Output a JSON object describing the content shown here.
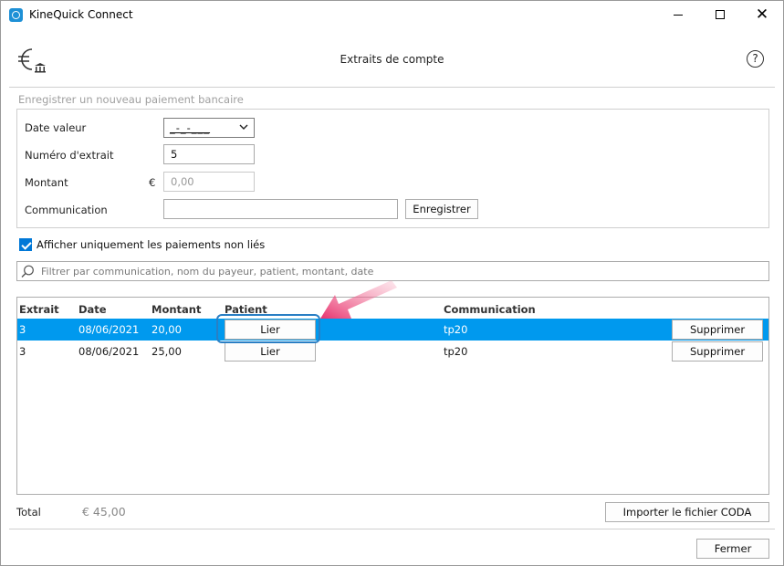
{
  "window": {
    "app_title": "KineQuick Connect",
    "icon": "kinequick-logo-icon"
  },
  "header": {
    "title": "Extraits de compte",
    "help_glyph": "?",
    "left_icon": "euro-bank-icon",
    "right_icon": "help-icon"
  },
  "form": {
    "group_title": "Enregistrer un nouveau paiement bancaire",
    "date_label": "Date valeur",
    "date_value": "_-_-___",
    "extract_label": "Numéro d'extrait",
    "extract_value": "5",
    "amount_label": "Montant",
    "currency_symbol": "€",
    "amount_placeholder": "0,00",
    "communication_label": "Communication",
    "communication_value": "",
    "save_label": "Enregistrer"
  },
  "filter": {
    "only_unlinked_label": "Afficher uniquement les paiements non liés",
    "only_unlinked_checked": true,
    "search_placeholder": "Filtrer par communication, nom du payeur, patient, montant, date"
  },
  "table": {
    "headers": {
      "extract": "Extrait",
      "date": "Date",
      "amount": "Montant",
      "patient": "Patient",
      "communication": "Communication"
    },
    "rows": [
      {
        "extract": "3",
        "date": "08/06/2021",
        "amount": "20,00",
        "link_label": "Lier",
        "communication": "tp20",
        "delete_label": "Supprimer",
        "selected": true
      },
      {
        "extract": "3",
        "date": "08/06/2021",
        "amount": "25,00",
        "link_label": "Lier",
        "communication": "tp20",
        "delete_label": "Supprimer",
        "selected": false
      }
    ]
  },
  "footer": {
    "total_label": "Total",
    "total_value": "€ 45,00",
    "import_label": "Importer le fichier CODA",
    "close_label": "Fermer"
  },
  "colors": {
    "selection": "#0099ee",
    "checkbox": "#0078d7",
    "annotation_arrow": "#e8336e",
    "annotation_box": "#2a7fc4"
  }
}
